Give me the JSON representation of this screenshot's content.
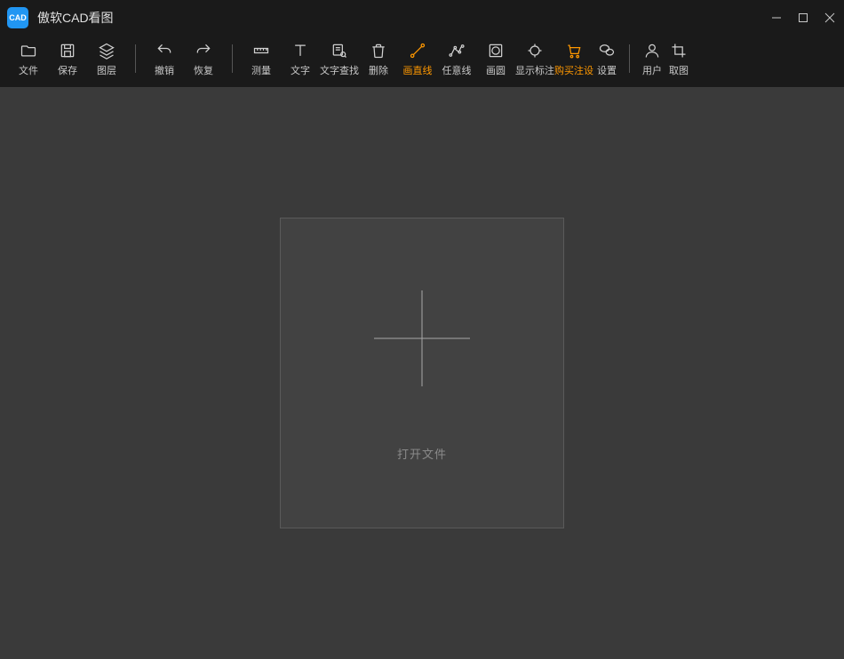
{
  "app": {
    "logo": "CAD",
    "title": "傲软CAD看图"
  },
  "toolbar": {
    "file": "文件",
    "save": "保存",
    "layers": "图层",
    "undo": "撤销",
    "redo": "恢复",
    "measure": "测量",
    "text": "文字",
    "text_search": "文字查找",
    "delete": "删除",
    "line": "画直线",
    "polyline": "任意线",
    "circle": "画圆",
    "show_annot": "显示标注",
    "buy_annot": "购买注设",
    "annot_settings": "设置",
    "user": "用户",
    "screenshot": "取图"
  },
  "main": {
    "open_file": "打开文件"
  }
}
